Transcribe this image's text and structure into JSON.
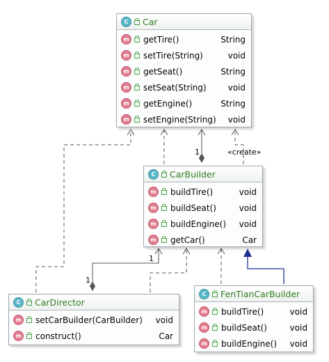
{
  "badges": {
    "class": "C",
    "method": "m"
  },
  "relations": {
    "multiplicity_one": "1",
    "create_stereotype": "«create»"
  },
  "classes": {
    "car": {
      "name": "Car",
      "methods": [
        {
          "name": "getTire()",
          "type": "String"
        },
        {
          "name": "setTire(String)",
          "type": "void"
        },
        {
          "name": "getSeat()",
          "type": "String"
        },
        {
          "name": "setSeat(String)",
          "type": "void"
        },
        {
          "name": "getEngine()",
          "type": "String"
        },
        {
          "name": "setEngine(String)",
          "type": "void"
        }
      ]
    },
    "car_builder": {
      "name": "CarBuilder",
      "methods": [
        {
          "name": "buildTire()",
          "type": "void"
        },
        {
          "name": "buildSeat()",
          "type": "void"
        },
        {
          "name": "buildEngine()",
          "type": "void"
        },
        {
          "name": "getCar()",
          "type": "Car"
        }
      ]
    },
    "car_director": {
      "name": "CarDirector",
      "methods": [
        {
          "name": "setCarBuilder(CarBuilder)",
          "type": "void"
        },
        {
          "name": "construct()",
          "type": "Car"
        }
      ]
    },
    "fentian_car_builder": {
      "name": "FenTianCarBuilder",
      "methods": [
        {
          "name": "buildTire()",
          "type": "void"
        },
        {
          "name": "buildSeat()",
          "type": "void"
        },
        {
          "name": "buildEngine()",
          "type": "void"
        }
      ]
    }
  }
}
